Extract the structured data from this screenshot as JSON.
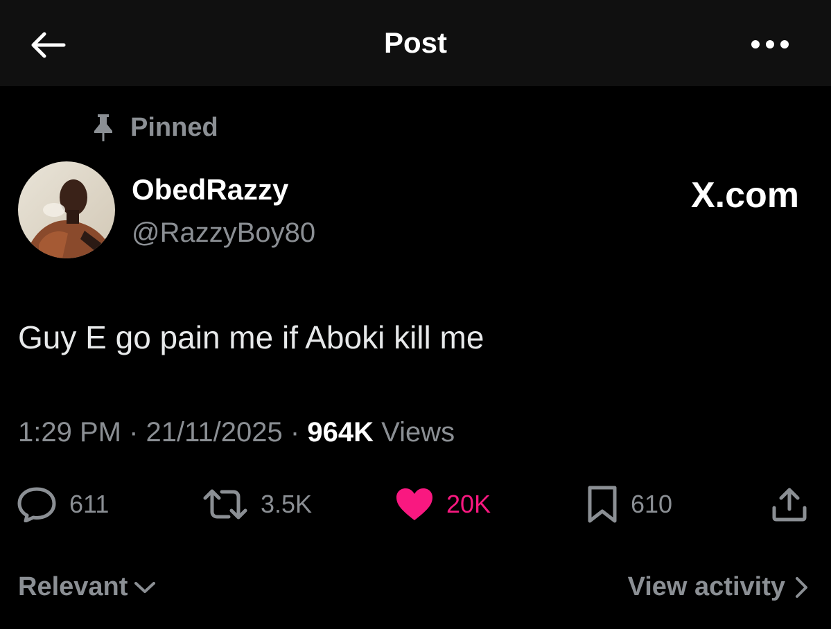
{
  "header": {
    "title": "Post",
    "back_icon": "arrow-left-icon",
    "more_icon": "more-horizontal-icon"
  },
  "post": {
    "pinned_label": "Pinned",
    "author": {
      "display_name": "ObedRazzy",
      "handle": "@RazzyBoy80"
    },
    "watermark": "X.com",
    "text": "Guy E go pain me if Aboki kill me",
    "time": "1:29 PM",
    "date": "21/11/2025",
    "views_count": "964K",
    "views_label": "Views",
    "separator": "·"
  },
  "actions": {
    "replies": "611",
    "reposts": "3.5K",
    "likes": "20K",
    "bookmarks": "610"
  },
  "footer": {
    "sort_label": "Relevant",
    "activity_label": "View activity"
  },
  "colors": {
    "background": "#000000",
    "header_bg": "#101010",
    "primary_text": "#ffffff",
    "secondary_text": "#8b8f94",
    "like_pink": "#f91880"
  }
}
